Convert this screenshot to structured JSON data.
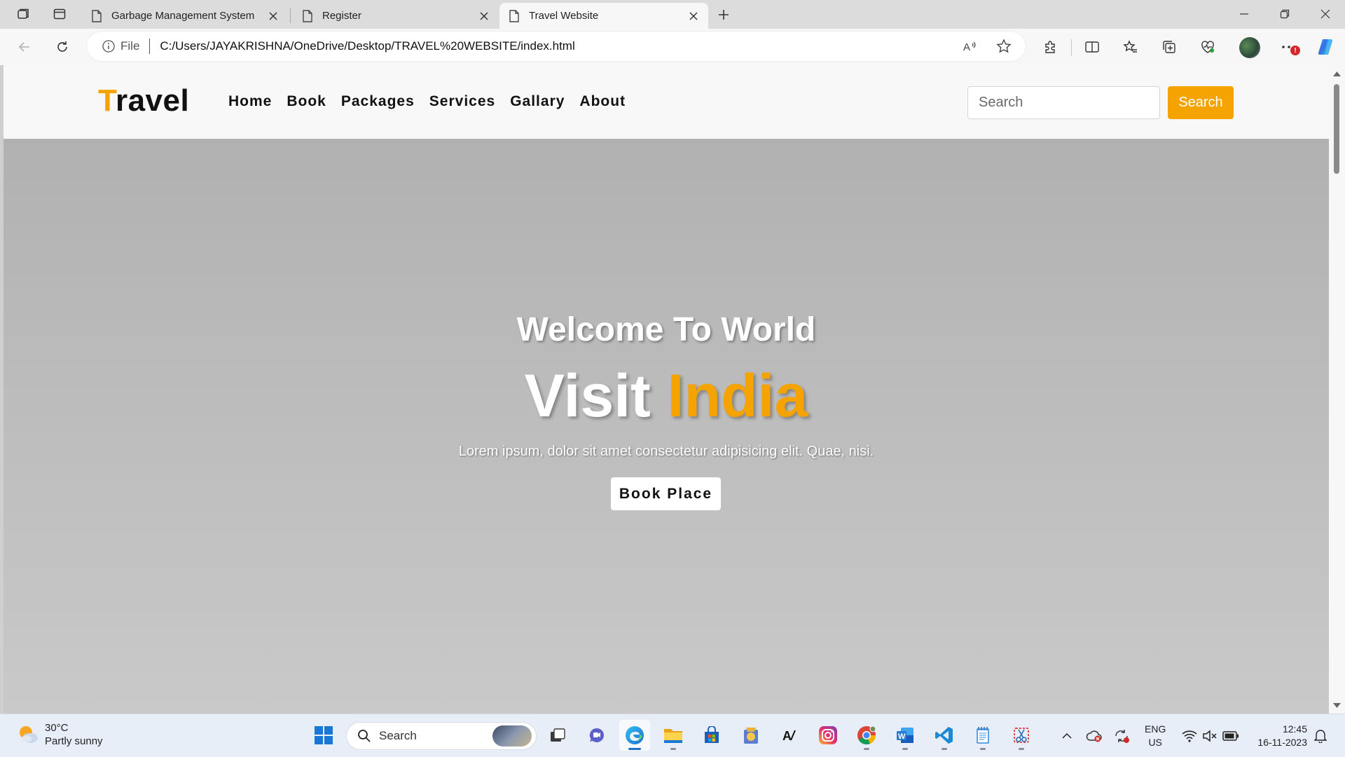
{
  "browser": {
    "tabs": [
      {
        "title": "Garbage Management System",
        "active": false
      },
      {
        "title": "Register",
        "active": false
      },
      {
        "title": "Travel Website",
        "active": true
      }
    ],
    "address": {
      "scheme_label": "File",
      "url": "C:/Users/JAYAKRISHNA/OneDrive/Desktop/TRAVEL%20WEBSITE/index.html"
    },
    "notification_badge": "!"
  },
  "site": {
    "logo": {
      "accent": "T",
      "rest": "ravel"
    },
    "nav": [
      "Home",
      "Book",
      "Packages",
      "Services",
      "Gallary",
      "About"
    ],
    "search": {
      "placeholder": "Search",
      "button": "Search"
    },
    "hero": {
      "subtitle": "Welcome To World",
      "title_plain": "Visit ",
      "title_accent": "India",
      "text": "Lorem ipsum, dolor sit amet consectetur adipisicing elit. Quae, nisi.",
      "button": "Book Place"
    },
    "colors": {
      "accent": "#f4a300",
      "nav_bg": "#f8f8f8",
      "hero_bg": "#c0c0c0"
    }
  },
  "taskbar": {
    "weather": {
      "temp": "30°C",
      "condition": "Partly sunny"
    },
    "search_label": "Search",
    "lang": {
      "line1": "ENG",
      "line2": "US"
    },
    "clock": {
      "time": "12:45",
      "date": "16-11-2023"
    }
  }
}
